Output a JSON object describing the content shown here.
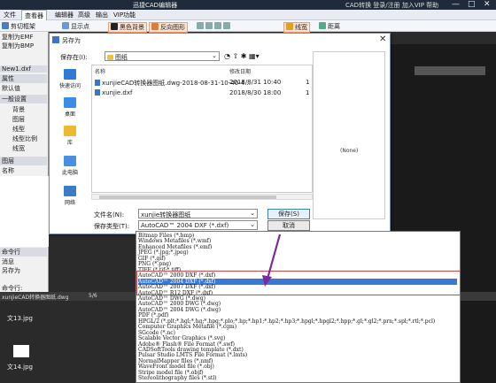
{
  "app": {
    "title": "迅捷CAD编辑器",
    "title_right": "CAD转换  登录/注册  加入VIP  帮助",
    "ctrl_min": "—",
    "ctrl_max": "□",
    "ctrl_close": "✕"
  },
  "menubar": {
    "items": [
      "文件",
      "查看器",
      "编辑器",
      "高级",
      "输出",
      "VIP功能"
    ]
  },
  "toolbar": {
    "items": [
      "剪切框架",
      "显示点",
      "黑色背景",
      "反向图形",
      "线宽",
      "距离"
    ]
  },
  "leftpanel": {
    "items": [
      "复制为EMF",
      "复制为BMP",
      "New1.dxf",
      "属性",
      "默认值",
      "一般设置",
      "背景",
      "图层",
      "线型",
      "线型比例",
      "线宽",
      "图层",
      "名称"
    ],
    "bottom_items": [
      "命令行",
      "消息",
      "另存为",
      "命令行:"
    ]
  },
  "dialog": {
    "title": "另存为",
    "close": "✕",
    "save_in_label": "保存在(I):",
    "save_in_value": "图纸",
    "nav": [
      "快速访问",
      "桌面",
      "库",
      "此电脑",
      "网络"
    ],
    "col_name": "名称",
    "col_date": "修改日期",
    "files": [
      {
        "name": "xunjieCAD转换器图纸.dwg-2018-08-31-10-40-4...",
        "date": "2018/8/31 10:40",
        "extra": "1"
      },
      {
        "name": "xunjie.dxf",
        "date": "2018/8/30 18:00",
        "extra": "1"
      }
    ],
    "filename_label": "文件名(N):",
    "filename_value": "xunjie转换器图纸",
    "filetype_label": "保存类型(T):",
    "filetype_value": "AutoCAD™ 2004 DXF (*.dxf)",
    "save_button": "保存(S)",
    "cancel_button": "取消",
    "preview_text": "(None)"
  },
  "filelist": {
    "header": "xunjieCAD转换器图纸.dwg",
    "header_count": "5/6",
    "items": [
      "文13.jpg",
      "文14.jpg"
    ]
  },
  "dropdown": {
    "options": [
      "Bitmap Files (*.bmp)",
      "Windows Metafiles (*.wmf)",
      "Enhanced Metafiles (*.emf)",
      "JPEG (*.jpg;*.jpeg)",
      "GIF (*.gif)",
      "PNG (*.png)",
      "TIFF (*.tif;*.tiff)",
      "AutoCAD™ 2000 DXF (*.dxf)",
      "AutoCAD™ 2004 DXF (*.dxf)",
      "AutoCAD™ 2007 DXF (*.dxf)",
      "AutoCAD™ R12 DXF (*.dxf)",
      "AutoCAD™ DWG (*.dwg)",
      "AutoCAD™ 2000 DWG (*.dwg)",
      "AutoCAD™ 2004 DWG (*.dwg)",
      "PDF (*.pdf)",
      "HPGL/2 (*.plt;*.hgl;*.hg;*.hpg;*.plo;*.hp;*.hp1;*.hp2;*.hp3;*.hpgl;*.hpgl2;*.hpp;*.gl;*.gl2;*.prn;*.spl;*.rtl;*.pcl)",
      "Computer Graphics Metafile (*.cgm)",
      "SGcode (*.nc)",
      "Scalable Vector Graphics (*.svg)",
      "Adobe® Flash® File Format (*.swf)",
      "CADSoftTools drawing template (*.dxt)",
      "Pulsar Studio LMTS File Format (*.lmts)",
      "NormalMapper files (*.nmf)",
      "WaveFront model file (*.obj)",
      "Stripe model file (*.objf)",
      "Stereolithography files (*.stl)"
    ],
    "selected_index": 8
  },
  "colors": {
    "accent": "#3a78d8",
    "highlight_box": "#d04848",
    "arrow": "#7a2a9a"
  }
}
